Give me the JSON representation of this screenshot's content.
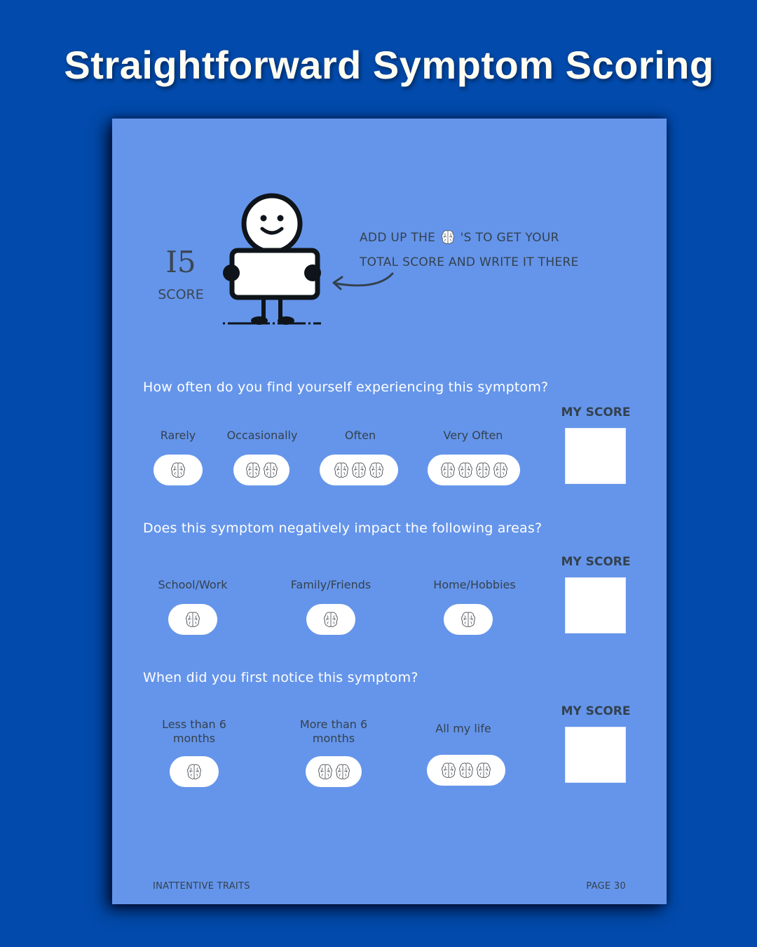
{
  "headline": "Straightforward Symptom Scoring",
  "header": {
    "example_score": "I5",
    "score_label": "SCORE",
    "instruction_line1_before": "ADD UP THE",
    "instruction_line1_after": "'S TO GET YOUR",
    "instruction_line2": "TOTAL SCORE AND WRITE IT THERE",
    "instruction_icon": "brain-icon"
  },
  "my_score_label": "MY SCORE",
  "sections": [
    {
      "question": "How often do you find yourself experiencing this symptom?",
      "options": [
        {
          "label": "Rarely",
          "brains": 1
        },
        {
          "label": "Occasionally",
          "brains": 2
        },
        {
          "label": "Often",
          "brains": 3
        },
        {
          "label": "Very Often",
          "brains": 4
        }
      ],
      "my_score_value": ""
    },
    {
      "question": "Does this symptom negatively impact the following areas?",
      "options": [
        {
          "label": "School/Work",
          "brains": 1
        },
        {
          "label": "Family/Friends",
          "brains": 1
        },
        {
          "label": "Home/Hobbies",
          "brains": 1
        }
      ],
      "my_score_value": ""
    },
    {
      "question": "When did you first notice this symptom?",
      "options": [
        {
          "label": "Less than 6 months",
          "line1": "Less than 6",
          "line2": "months",
          "brains": 1
        },
        {
          "label": "More than 6 months",
          "line1": "More than 6",
          "line2": "months",
          "brains": 2
        },
        {
          "label": "All my life",
          "line1": "All my life",
          "line2": "",
          "brains": 3
        }
      ],
      "my_score_value": ""
    }
  ],
  "footer": {
    "section_name": "INATTENTIVE TRAITS",
    "page_label": "PAGE 30"
  },
  "colors": {
    "background": "#024aab",
    "page": "#6595ea",
    "ink": "#33414f",
    "white": "#ffffff"
  }
}
